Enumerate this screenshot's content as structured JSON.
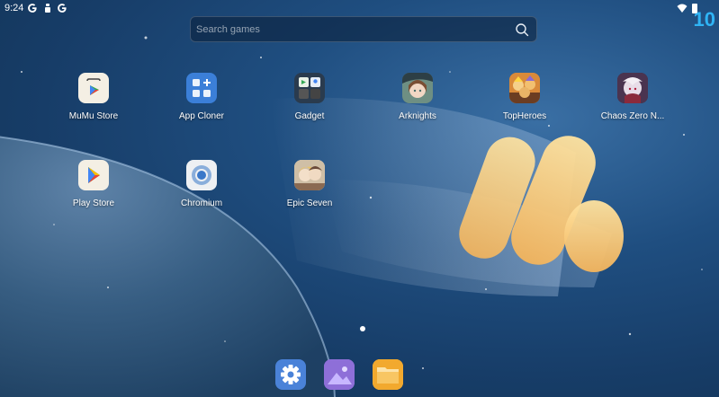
{
  "status_bar": {
    "time": "9:24",
    "icons": [
      "google-g-icon",
      "notification-icon",
      "google-g-icon",
      "wifi-icon",
      "battery-icon"
    ],
    "corner_number": "10"
  },
  "search": {
    "placeholder": "Search games",
    "value": ""
  },
  "apps": [
    {
      "label": "MuMu Store",
      "icon": "mumu-store-icon"
    },
    {
      "label": "App Cloner",
      "icon": "app-cloner-icon"
    },
    {
      "label": "Gadget",
      "icon": "gadget-icon"
    },
    {
      "label": "Arknights",
      "icon": "arknights-icon"
    },
    {
      "label": "TopHeroes",
      "icon": "topheroes-icon"
    },
    {
      "label": "Chaos Zero N...",
      "icon": "chaos-zero-icon"
    },
    {
      "label": "Play Store",
      "icon": "play-store-icon"
    },
    {
      "label": "Chromium",
      "icon": "chromium-icon"
    },
    {
      "label": "Epic Seven",
      "icon": "epic-seven-icon"
    }
  ],
  "dock": [
    {
      "icon": "settings-icon"
    },
    {
      "icon": "gallery-icon"
    },
    {
      "icon": "files-icon"
    }
  ],
  "colors": {
    "accent": "#2fb4f5",
    "wallpaper_dark": "#10304f",
    "wallpaper_light": "#3a6fa4"
  }
}
